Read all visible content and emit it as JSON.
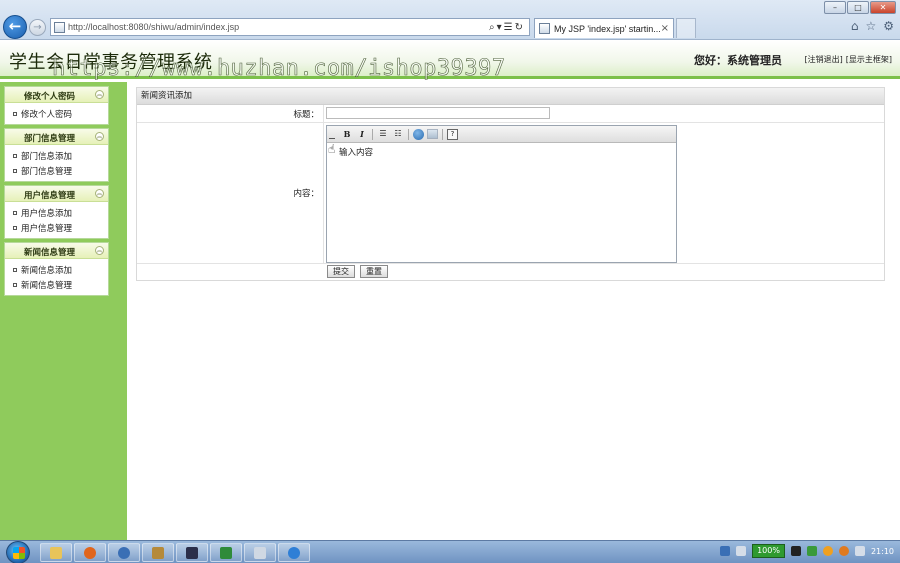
{
  "browser": {
    "address": "http://localhost:8080/shiwu/admin/index.jsp",
    "tab_label": "My JSP 'index.jsp' startin...",
    "tab_close": "×",
    "window_min": "–",
    "window_max": "□",
    "window_close": "✕"
  },
  "header": {
    "title": "学生会日常事务管理系统",
    "watermark": "https://www.huzhan.com/ishop39397",
    "welcome": "您好：系统管理员",
    "logout_link": "[注销退出]",
    "show_frame_link": "[显示主框架]"
  },
  "sidebar": {
    "groups": [
      {
        "title": "修改个人密码",
        "items": [
          "修改个人密码"
        ]
      },
      {
        "title": "部门信息管理",
        "items": [
          "部门信息添加",
          "部门信息管理"
        ]
      },
      {
        "title": "用户信息管理",
        "items": [
          "用户信息添加",
          "用户信息管理"
        ]
      },
      {
        "title": "新闻信息管理",
        "items": [
          "新闻信息添加",
          "新闻信息管理"
        ]
      }
    ]
  },
  "form": {
    "panel_title": "新闻资讯添加",
    "title_label": "标题：",
    "title_value": "",
    "content_label": "内容：",
    "content_placeholder": "输入内容",
    "submit_label": "提交",
    "reset_label": "重置"
  },
  "editor_toolbar": {
    "bold": "B",
    "italic": "I",
    "help": "?"
  },
  "taskbar": {
    "battery": "100%",
    "clock": "21:10"
  },
  "colors": {
    "sidebar_green": "#8fcb5c",
    "header_stripe": "#7cc04a",
    "browser_chrome": "#c9d9ec"
  }
}
